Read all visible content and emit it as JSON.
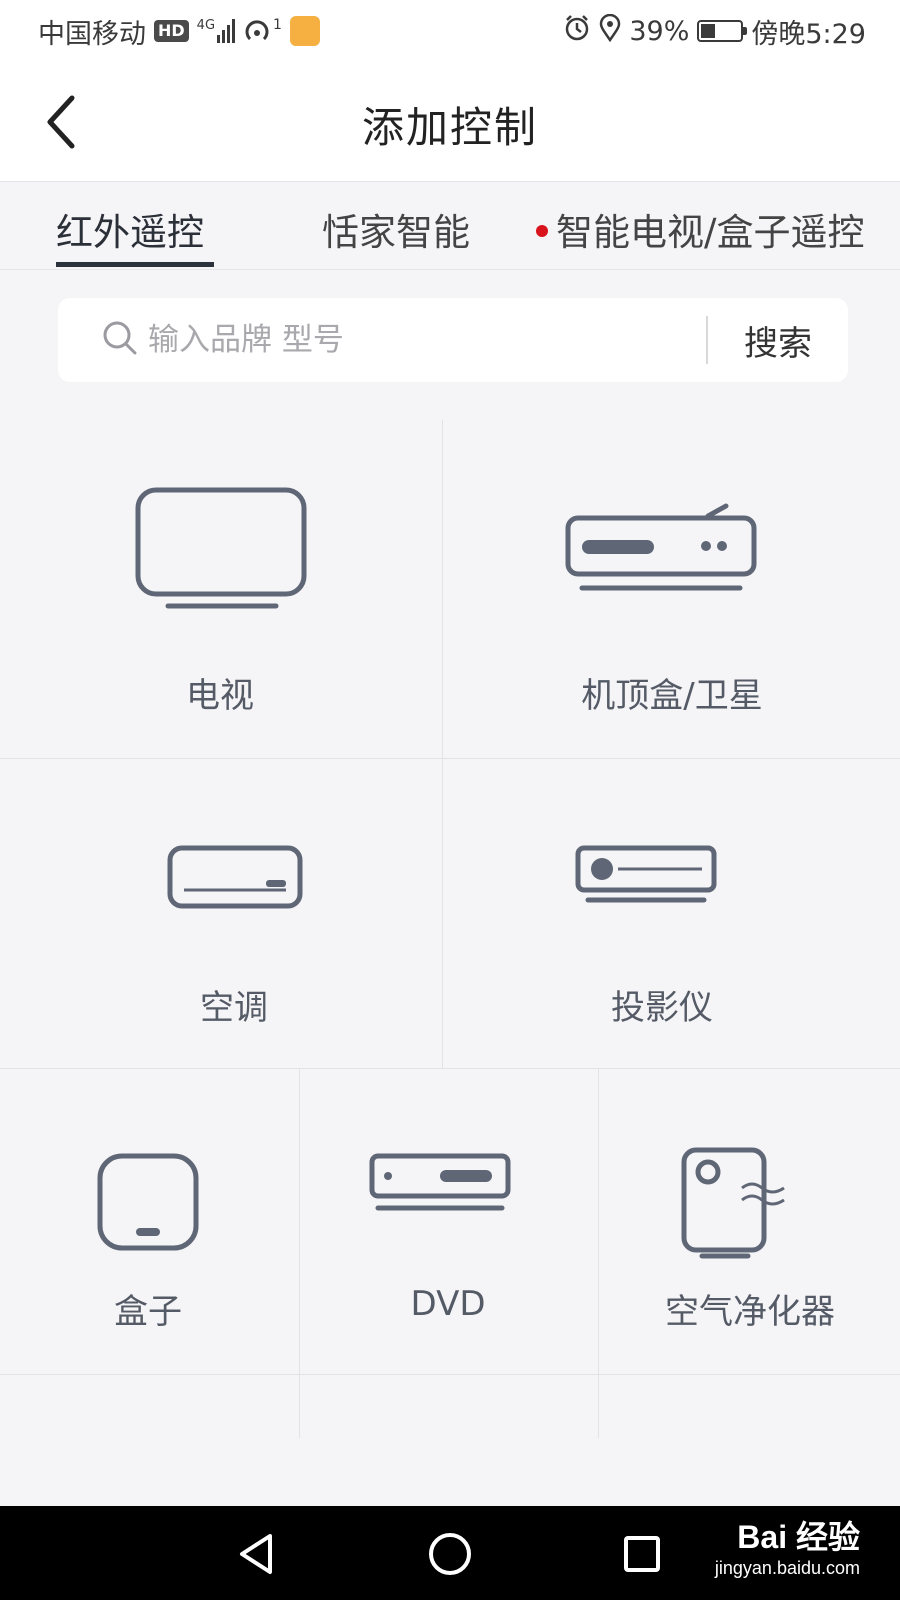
{
  "status_bar": {
    "carrier": "中国移动",
    "hd_badge": "HD",
    "network": "4G",
    "hotspot_count": "1",
    "battery_percent": "39%",
    "time": "傍晚5:29",
    "icons": [
      "hd-icon",
      "signal-icon",
      "hotspot-icon",
      "app-notification-icon",
      "alarm-icon",
      "location-icon",
      "battery-charging-icon"
    ]
  },
  "header": {
    "title": "添加控制",
    "back_icon": "chevron-left-icon"
  },
  "tabs": [
    {
      "label": "红外遥控",
      "active": true
    },
    {
      "label": "恬家智能",
      "active": false
    },
    {
      "label": "智能电视/盒子遥控",
      "active": false,
      "badge_color": "#d9131b"
    }
  ],
  "search": {
    "placeholder": "输入品牌 型号",
    "value": "",
    "button_label": "搜索"
  },
  "devices": [
    {
      "label": "电视",
      "icon": "tv-icon"
    },
    {
      "label": "机顶盒/卫星",
      "icon": "set-top-box-icon"
    },
    {
      "label": "空调",
      "icon": "air-conditioner-icon"
    },
    {
      "label": "投影仪",
      "icon": "projector-icon"
    },
    {
      "label": "盒子",
      "icon": "box-icon"
    },
    {
      "label": "DVD",
      "icon": "dvd-icon"
    },
    {
      "label": "空气净化器",
      "icon": "air-purifier-icon"
    }
  ],
  "nav_bar": {
    "buttons": [
      "back-triangle-icon",
      "home-circle-icon",
      "recents-square-icon"
    ]
  },
  "watermark": {
    "logo": "Bai 经验",
    "url": "jingyan.baidu.com"
  },
  "colors": {
    "icon_stroke": "#5f6675",
    "active_tab_underline": "#2c323c",
    "tab_badge": "#d9131b",
    "background": "#f5f5f7"
  }
}
